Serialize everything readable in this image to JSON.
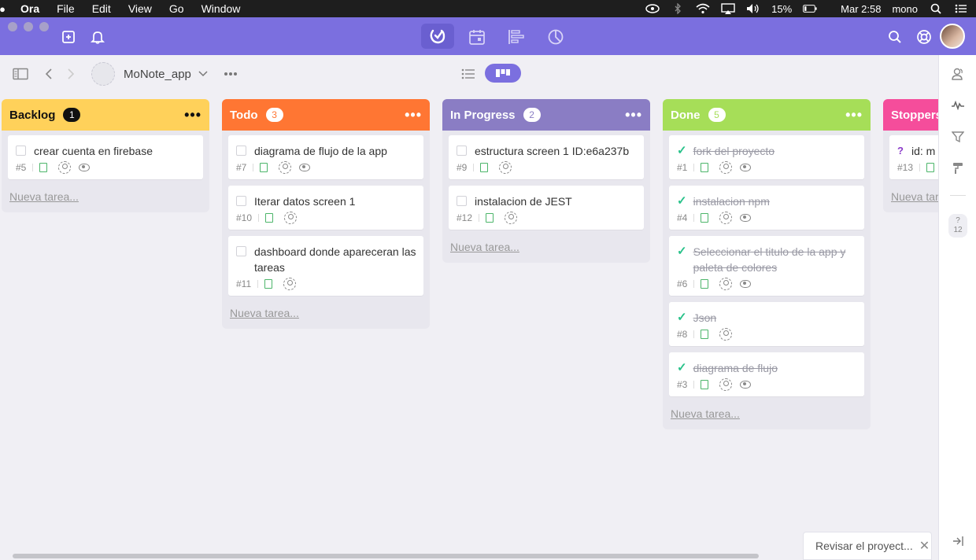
{
  "menubar": {
    "app": "Ora",
    "items": [
      "File",
      "Edit",
      "View",
      "Go",
      "Window"
    ],
    "battery": "15%",
    "clock": "Mar 2:58",
    "user": "mono"
  },
  "project": {
    "name": "MoNote_app"
  },
  "columns": [
    {
      "title": "Backlog",
      "count": "1",
      "color": "#ffd15a",
      "text_color": "#111111",
      "cards": [
        {
          "title": "crear cuenta en firebase",
          "id": "#5",
          "done": false,
          "watch": true
        }
      ]
    },
    {
      "title": "Todo",
      "count": "3",
      "color": "#ff7633",
      "text_color": "#ffffff",
      "cards": [
        {
          "title": "diagrama de flujo de la app",
          "id": "#7",
          "done": false,
          "watch": true
        },
        {
          "title": "Iterar datos screen 1",
          "id": "#10",
          "done": false,
          "watch": false
        },
        {
          "title": "dashboard donde apareceran las tareas",
          "id": "#11",
          "done": false,
          "watch": false
        }
      ]
    },
    {
      "title": "In Progress",
      "count": "2",
      "color": "#8a7dc4",
      "text_color": "#ffffff",
      "cards": [
        {
          "title": "estructura screen 1 ID:e6a237b",
          "id": "#9",
          "done": false,
          "watch": false
        },
        {
          "title": "instalacion de JEST",
          "id": "#12",
          "done": false,
          "watch": false
        }
      ]
    },
    {
      "title": "Done",
      "count": "5",
      "color": "#a6de58",
      "text_color": "#ffffff",
      "cards": [
        {
          "title": "fork del proyecto",
          "id": "#1",
          "done": true,
          "watch": true
        },
        {
          "title": "instalacion npm",
          "id": "#4",
          "done": true,
          "watch": true
        },
        {
          "title": "Seleccionar el titulo de la app y paleta de colores",
          "id": "#6",
          "done": true,
          "watch": true
        },
        {
          "title": "Json",
          "id": "#8",
          "done": true,
          "watch": false
        },
        {
          "title": "diagrama de flujo",
          "id": "#3",
          "done": true,
          "watch": true
        }
      ]
    },
    {
      "title": "Stoppers",
      "count": "",
      "color": "#f54d9b",
      "text_color": "#ffffff",
      "cards": [
        {
          "title": "id: m",
          "id": "#13",
          "done": false,
          "watch": false,
          "question": "?"
        }
      ]
    }
  ],
  "new_task_label": "Nueva tarea...",
  "sidebar": {
    "help_mark": "?",
    "help_count": "12"
  },
  "toast": {
    "text": "Revisar el proyect..."
  }
}
